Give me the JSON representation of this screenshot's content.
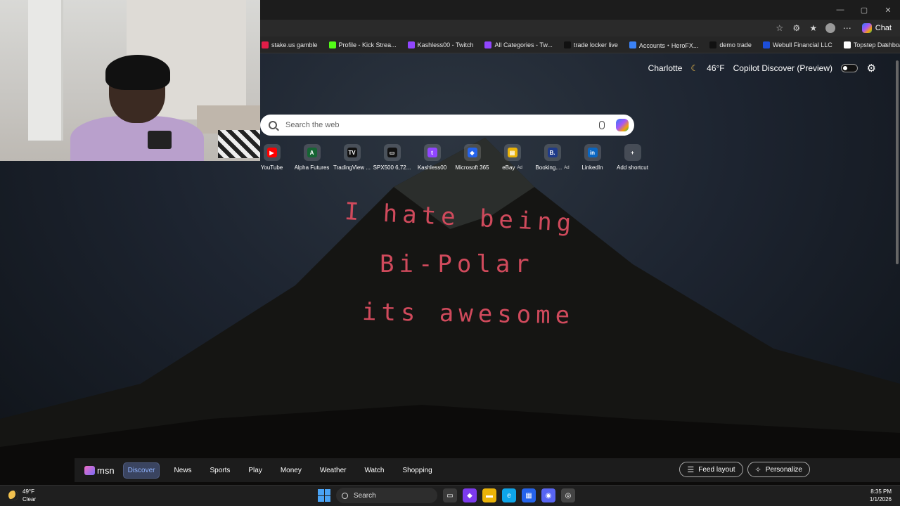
{
  "browser": {
    "window_controls": [
      "—",
      "▢",
      "✕"
    ],
    "chat_label": "Chat",
    "bookmarks": [
      {
        "label": "stake.us gamble",
        "color": "#e11d48"
      },
      {
        "label": "Profile - Kick Strea...",
        "color": "#53fc18"
      },
      {
        "label": "Kashless00 - Twitch",
        "color": "#9146ff"
      },
      {
        "label": "All Categories - Tw...",
        "color": "#9146ff"
      },
      {
        "label": "trade locker live",
        "color": "#111111"
      },
      {
        "label": "Accounts・HeroFX...",
        "color": "#3b82f6"
      },
      {
        "label": "demo trade",
        "color": "#111111"
      },
      {
        "label": "Webull Financial LLC",
        "color": "#1d4ed8"
      },
      {
        "label": "Topstep Dashboard",
        "color": "#ffffff"
      }
    ],
    "bookmarks_more": "›"
  },
  "newtab": {
    "city": "Charlotte",
    "temp": "46°F",
    "copilot_label": "Copilot Discover (Preview)",
    "search_placeholder": "Search the web",
    "shortcuts": [
      {
        "label": "YouTube",
        "glyph": "▶",
        "color": "#ff0000",
        "ad": ""
      },
      {
        "label": "Alpha Futures",
        "glyph": "A",
        "color": "#166534",
        "ad": ""
      },
      {
        "label": "TradingView ...",
        "glyph": "TV",
        "color": "#111111",
        "ad": ""
      },
      {
        "label": "SPX500 6,72...",
        "glyph": "▭",
        "color": "#111111",
        "ad": ""
      },
      {
        "label": "Kashless00",
        "glyph": "t",
        "color": "#9146ff",
        "ad": ""
      },
      {
        "label": "Microsoft 365",
        "glyph": "◆",
        "color": "#2563eb",
        "ad": ""
      },
      {
        "label": "eBay",
        "glyph": "▤",
        "color": "#eab308",
        "ad": "Ad"
      },
      {
        "label": "Booking....",
        "glyph": "B.",
        "color": "#1e3a8a",
        "ad": "Ad"
      },
      {
        "label": "LinkedIn",
        "glyph": "in",
        "color": "#0a66c2",
        "ad": ""
      },
      {
        "label": "Add shortcut",
        "glyph": "+",
        "color": "transparent",
        "ad": ""
      }
    ],
    "handwriting": [
      "I hate being",
      "Bi-Polar",
      "its awesome"
    ]
  },
  "msn": {
    "logo": "msn",
    "nav": [
      "Discover",
      "News",
      "Sports",
      "Play",
      "Money",
      "Weather",
      "Watch",
      "Shopping"
    ],
    "feed_layout": "Feed layout",
    "personalize": "Personalize"
  },
  "taskbar": {
    "weather_temp": "49°F",
    "weather_cond": "Clear",
    "search_label": "Search",
    "time": "8:35 PM",
    "date": "1/1/2026",
    "apps": [
      {
        "name": "task-view",
        "glyph": "▭",
        "color": "#3a3a3a"
      },
      {
        "name": "copilot",
        "glyph": "◆",
        "color": "#7c3aed"
      },
      {
        "name": "file-explorer",
        "glyph": "▬",
        "color": "#eab308"
      },
      {
        "name": "edge",
        "glyph": "e",
        "color": "#0ea5e9"
      },
      {
        "name": "store",
        "glyph": "▦",
        "color": "#2563eb"
      },
      {
        "name": "discord",
        "glyph": "◉",
        "color": "#5865f2"
      },
      {
        "name": "chrome",
        "glyph": "◎",
        "color": "#444444"
      }
    ]
  }
}
